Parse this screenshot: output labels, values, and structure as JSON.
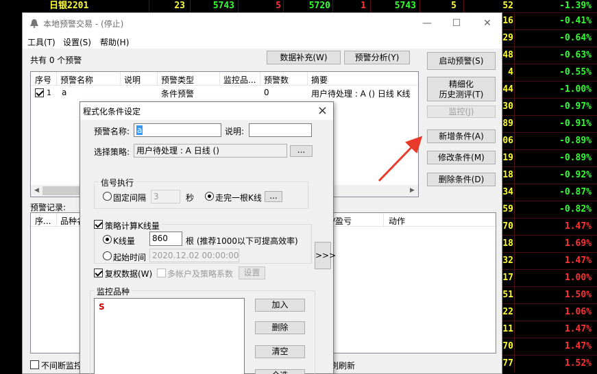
{
  "bg_top": {
    "name": "日银2201",
    "v1": "23",
    "v2": "5743",
    "v3": "5",
    "v4": "5720",
    "v5": "1",
    "v6": "5743",
    "v7": "5"
  },
  "bg_rows": [
    {
      "a": "52",
      "b": "-1.39%",
      "color": "#33ff33"
    },
    {
      "a": "16",
      "b": "-0.41%",
      "color": "#33ff33"
    },
    {
      "a": "29",
      "b": "-0.64%",
      "color": "#33ff33"
    },
    {
      "a": "48",
      "b": "-0.63%",
      "color": "#33ff33"
    },
    {
      "a": "4",
      "b": "-0.55%",
      "color": "#33ff33"
    },
    {
      "a": "44",
      "b": "-1.00%",
      "color": "#33ff33"
    },
    {
      "a": "30",
      "b": "-0.97%",
      "color": "#33ff33"
    },
    {
      "a": "89",
      "b": "-0.91%",
      "color": "#33ff33"
    },
    {
      "a": "06",
      "b": "-0.89%",
      "color": "#33ff33"
    },
    {
      "a": "19",
      "b": "-0.89%",
      "color": "#33ff33"
    },
    {
      "a": "18",
      "b": "-0.92%",
      "color": "#33ff33"
    },
    {
      "a": "34",
      "b": "-0.87%",
      "color": "#33ff33"
    },
    {
      "a": "59",
      "b": "-0.82%",
      "color": "#33ff33"
    },
    {
      "a": "70",
      "b": "1.47%",
      "color": "#ff3333"
    },
    {
      "a": "18",
      "b": "1.69%",
      "color": "#ff3333"
    },
    {
      "a": "32",
      "b": "1.47%",
      "color": "#ff3333"
    },
    {
      "a": "17",
      "b": "1.00%",
      "color": "#ff3333"
    },
    {
      "a": "51",
      "b": "1.50%",
      "color": "#ff3333"
    },
    {
      "a": "22",
      "b": "1.06%",
      "color": "#ff3333"
    },
    {
      "a": "11",
      "b": "1.47%",
      "color": "#ff3333"
    },
    {
      "a": "70",
      "b": "1.47%",
      "color": "#ff3333"
    },
    {
      "a": "77",
      "b": "1.52%",
      "color": "#ff3333"
    }
  ],
  "window": {
    "title": "本地预警交易  - (停止)"
  },
  "menu": [
    "工具(T)",
    "设置(S)",
    "帮助(H)"
  ],
  "summary": "共有 0 个预警",
  "buttons": {
    "data_fill": "数据补充(W)",
    "alert_analysis": "预警分析(Y)",
    "start_alert": "启动预警(S)",
    "refine_l1": "精细化",
    "refine_l2": "历史测评(T)",
    "monitor": "监控(J)",
    "add_cond": "新增条件(A)",
    "edit_cond": "修改条件(M)",
    "del_cond": "删除条件(D)"
  },
  "alert_table": {
    "columns": [
      "序号",
      "预警名称",
      "说明",
      "预警类型",
      "监控品...",
      "预警数",
      "摘要"
    ],
    "row": {
      "index": "1",
      "name": "a",
      "type": "条件预警",
      "count": "0",
      "summary": "用户待处理 : A () 日线 K线"
    }
  },
  "records_label": "预警记录:",
  "record_columns": [
    "序...",
    "品种名",
    "/盈亏",
    "动作"
  ],
  "footer": {
    "left": "不间断监控",
    "right": "刷刷新"
  },
  "dialog": {
    "title": "程式化条件设定",
    "alert_name_label": "预警名称:",
    "alert_name_value": "a",
    "desc_label": "说明:",
    "strategy_label": "选择策略:",
    "strategy_value": "用户待处理 : A 日线 ()",
    "browse": "...",
    "signal_group": "信号执行",
    "fixed_interval": "固定间隔",
    "interval_value": "3",
    "sec": "秒",
    "after_kline": "走完一根K线",
    "kline_group_label": "策略计算K线量",
    "kline_count_label": "K线量",
    "kline_count_value": "860",
    "kline_hint": "根 (推荐1000以下可提高效率)",
    "start_time_label": "起始时间",
    "start_time_value": "2020.12.02 00:00:00",
    "expand": ">>>",
    "adjusted": "复权数据(W)",
    "multi_account": "多帐户及策略系数",
    "settings": "设置",
    "monitor_group": "监控品种",
    "monitor_item": "S",
    "add": "加入",
    "remove": "删除",
    "clear": "清空",
    "select_all": "全选"
  }
}
